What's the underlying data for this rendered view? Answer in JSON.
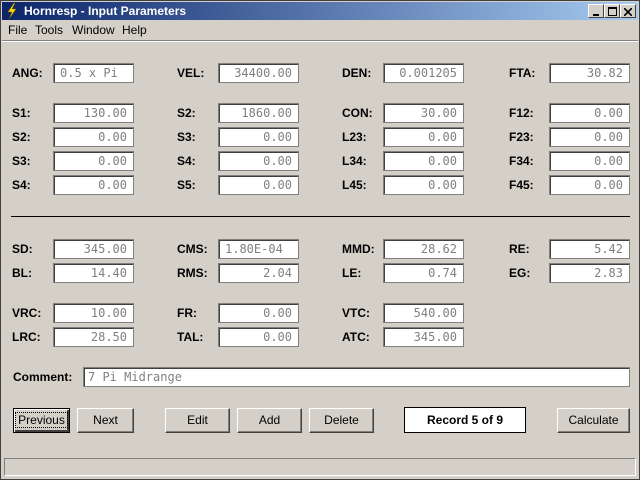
{
  "window": {
    "title": "Hornresp - Input Parameters"
  },
  "menu": [
    "File",
    "Tools",
    "Window",
    "Help"
  ],
  "fields": {
    "ANG": {
      "label": "ANG:",
      "value": "0.5 x Pi"
    },
    "VEL": {
      "label": "VEL:",
      "value": "34400.00"
    },
    "DEN": {
      "label": "DEN:",
      "value": "0.001205"
    },
    "FTA": {
      "label": "FTA:",
      "value": "30.82"
    },
    "S1": {
      "label": "S1:",
      "value": "130.00"
    },
    "S2a": {
      "label": "S2:",
      "value": "1860.00"
    },
    "CON": {
      "label": "CON:",
      "value": "30.00"
    },
    "F12": {
      "label": "F12:",
      "value": "0.00"
    },
    "S2": {
      "label": "S2:",
      "value": "0.00"
    },
    "S3a": {
      "label": "S3:",
      "value": "0.00"
    },
    "L23": {
      "label": "L23:",
      "value": "0.00"
    },
    "F23": {
      "label": "F23:",
      "value": "0.00"
    },
    "S3": {
      "label": "S3:",
      "value": "0.00"
    },
    "S4a": {
      "label": "S4:",
      "value": "0.00"
    },
    "L34": {
      "label": "L34:",
      "value": "0.00"
    },
    "F34": {
      "label": "F34:",
      "value": "0.00"
    },
    "S4": {
      "label": "S4:",
      "value": "0.00"
    },
    "S5": {
      "label": "S5:",
      "value": "0.00"
    },
    "L45": {
      "label": "L45:",
      "value": "0.00"
    },
    "F45": {
      "label": "F45:",
      "value": "0.00"
    },
    "SD": {
      "label": "SD:",
      "value": "345.00"
    },
    "CMS": {
      "label": "CMS:",
      "value": "1.80E-04"
    },
    "MMD": {
      "label": "MMD:",
      "value": "28.62"
    },
    "RE": {
      "label": "RE:",
      "value": "5.42"
    },
    "BL": {
      "label": "BL:",
      "value": "14.40"
    },
    "RMS": {
      "label": "RMS:",
      "value": "2.04"
    },
    "LE": {
      "label": "LE:",
      "value": "0.74"
    },
    "EG": {
      "label": "EG:",
      "value": "2.83"
    },
    "VRC": {
      "label": "VRC:",
      "value": "10.00"
    },
    "FR": {
      "label": "FR:",
      "value": "0.00"
    },
    "VTC": {
      "label": "VTC:",
      "value": "540.00"
    },
    "LRC": {
      "label": "LRC:",
      "value": "28.50"
    },
    "TAL": {
      "label": "TAL:",
      "value": "0.00"
    },
    "ATC": {
      "label": "ATC:",
      "value": "345.00"
    }
  },
  "comment": {
    "label": "Comment:",
    "value": "7 Pi Midrange"
  },
  "buttons": {
    "previous": "Previous",
    "next": "Next",
    "edit": "Edit",
    "add": "Add",
    "delete": "Delete",
    "calculate": "Calculate"
  },
  "record": "Record 5 of 9"
}
